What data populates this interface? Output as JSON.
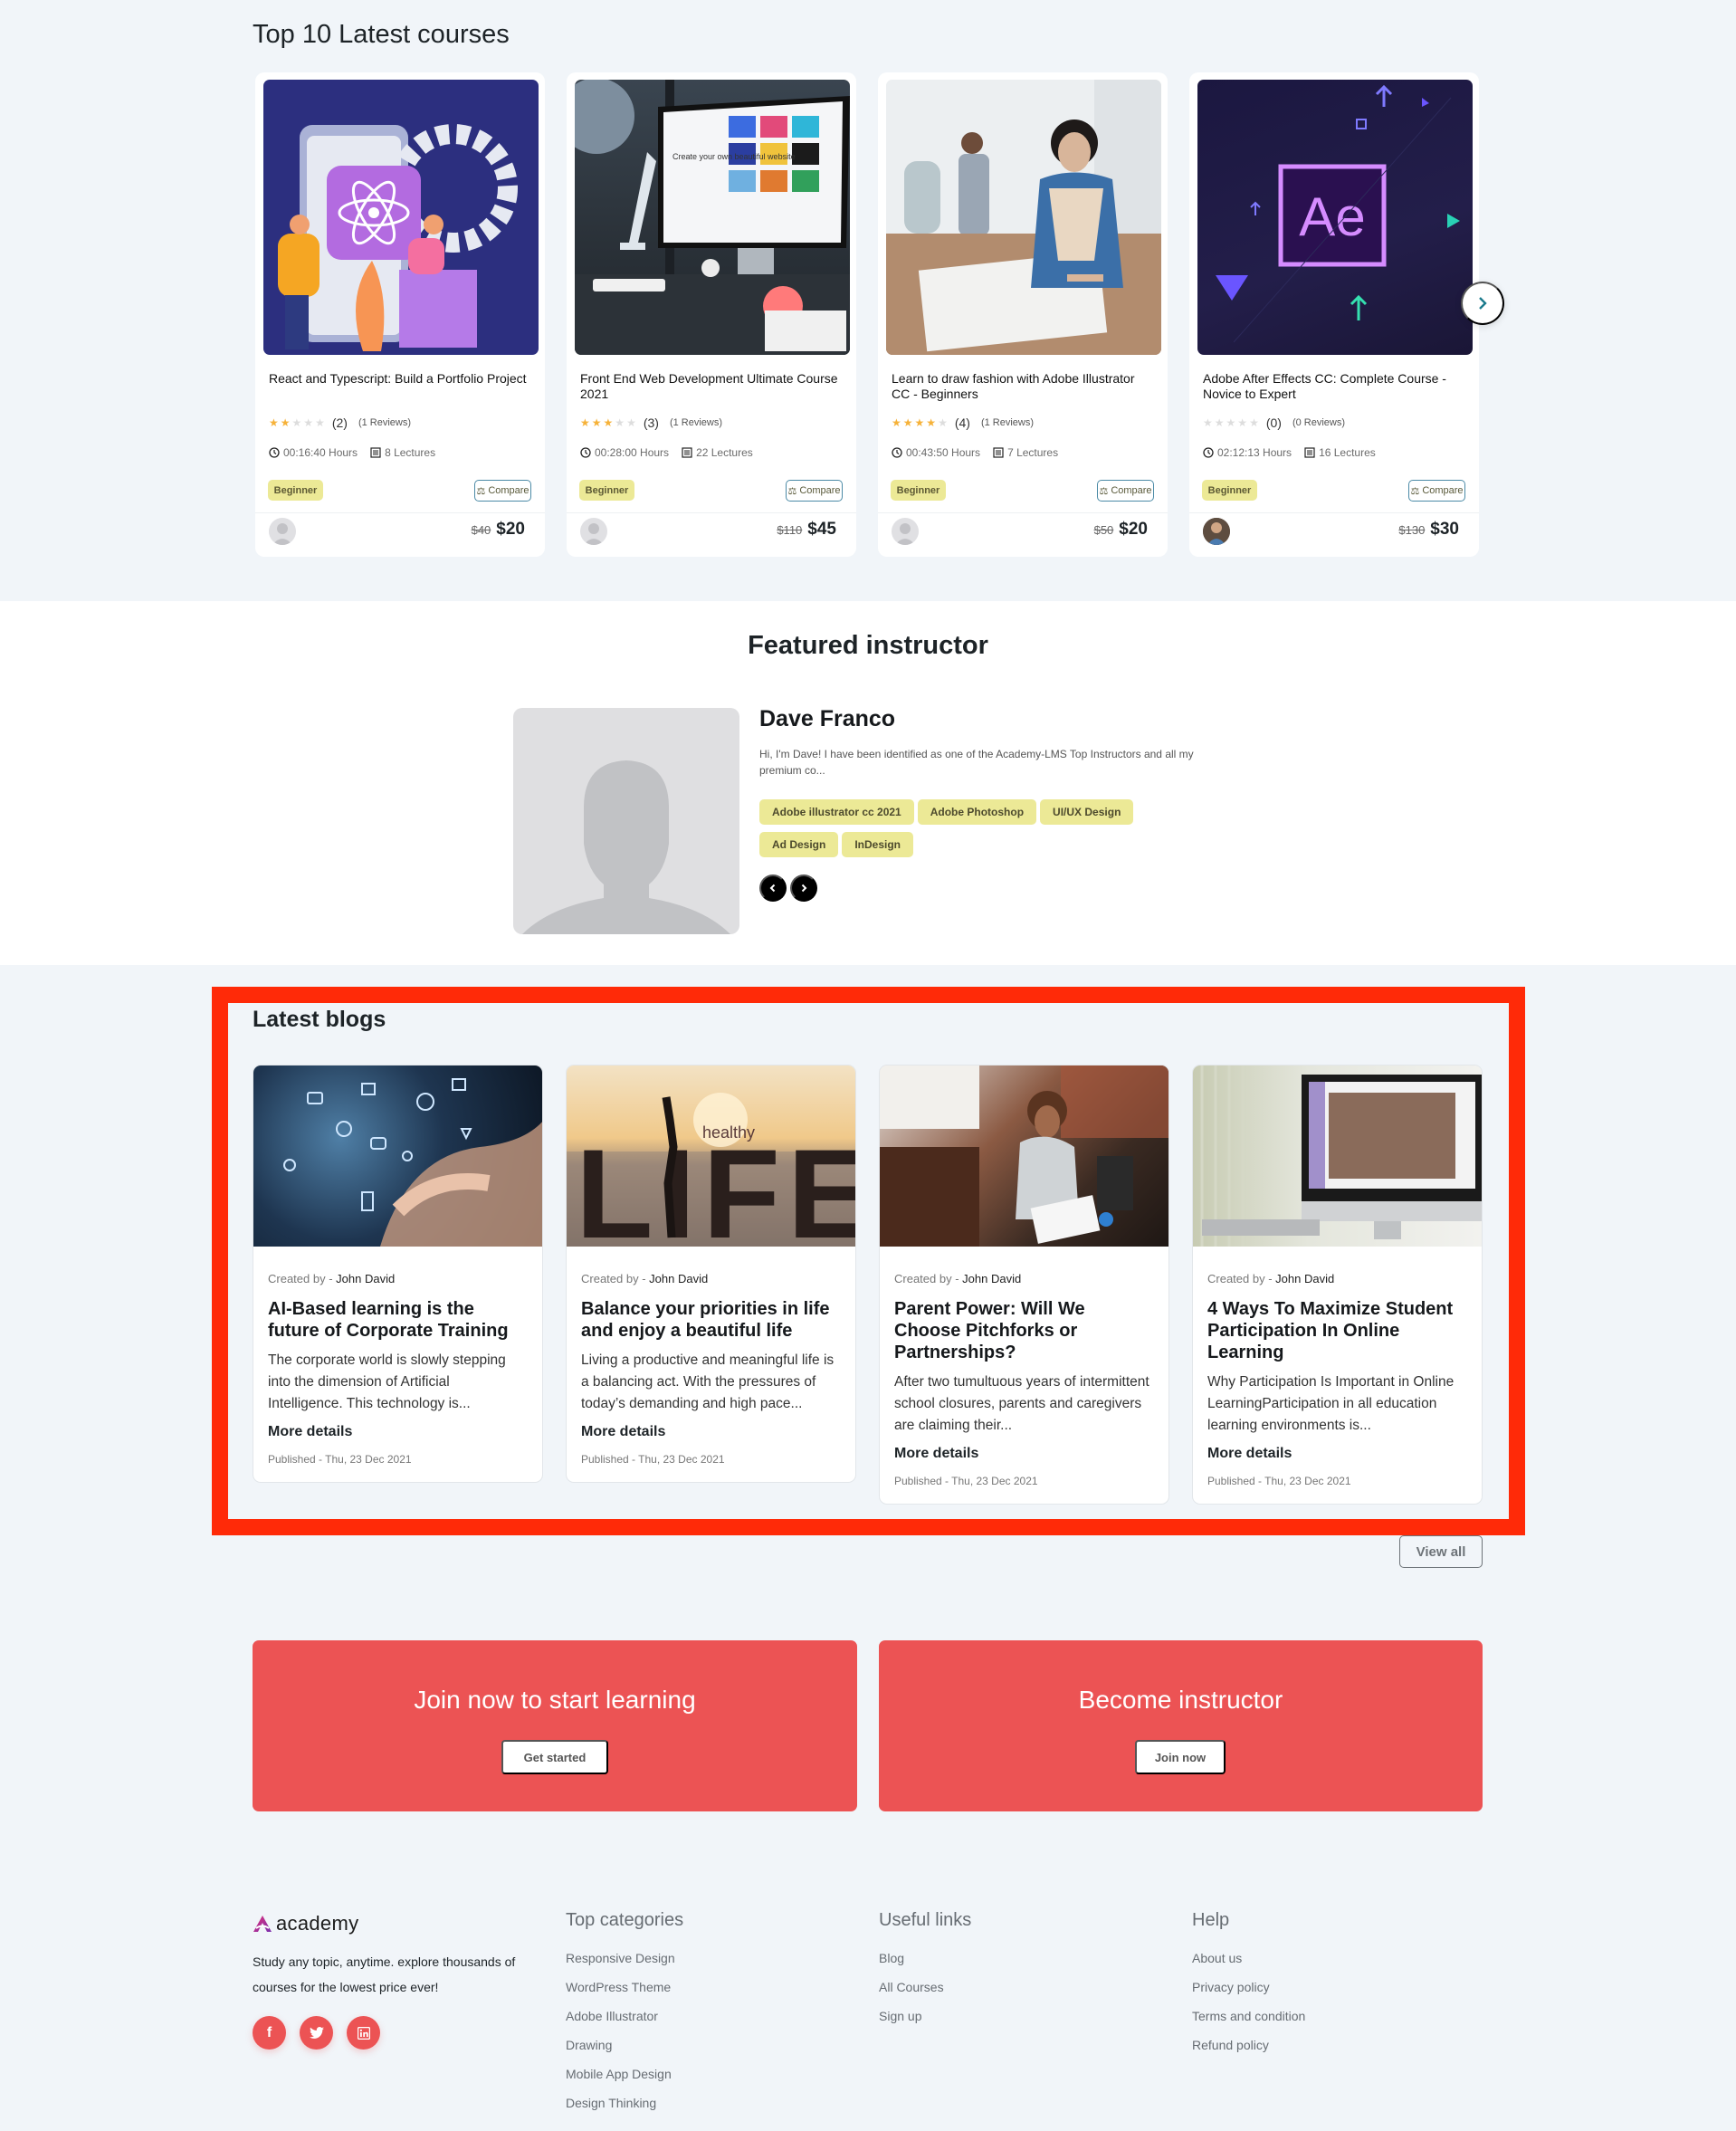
{
  "courses": {
    "title": "Top 10 Latest courses",
    "items": [
      {
        "name": "React and Typescript: Build a Portfolio Project",
        "stars": 2,
        "rating": "(2)",
        "reviews": "(1 Reviews)",
        "duration": "00:16:40 Hours",
        "lectures": "8 Lectures",
        "level": "Beginner",
        "compare": "Compare",
        "old_price": "$40",
        "price": "$20",
        "thumb": "react-illustration"
      },
      {
        "name": "Front End Web Development Ultimate Course 2021",
        "stars": 3,
        "rating": "(3)",
        "reviews": "(1 Reviews)",
        "duration": "00:28:00 Hours",
        "lectures": "22 Lectures",
        "level": "Beginner",
        "compare": "Compare",
        "old_price": "$110",
        "price": "$45",
        "thumb": "desk-computer-photo",
        "screen_text": "Create your own beautiful website"
      },
      {
        "name": "Learn to draw fashion with Adobe Illustrator CC - Beginners",
        "stars": 4,
        "rating": "(4)",
        "reviews": "(1 Reviews)",
        "duration": "00:43:50 Hours",
        "lectures": "7 Lectures",
        "level": "Beginner",
        "compare": "Compare",
        "old_price": "$50",
        "price": "$20",
        "thumb": "fashion-designer-photo"
      },
      {
        "name": "Adobe After Effects CC: Complete Course - Novice to Expert",
        "stars": 0,
        "rating": "(0)",
        "reviews": "(0 Reviews)",
        "duration": "02:12:13 Hours",
        "lectures": "16 Lectures",
        "level": "Beginner",
        "compare": "Compare",
        "old_price": "$130",
        "price": "$30",
        "thumb": "after-effects-logo",
        "logo_text": "Ae"
      }
    ],
    "next_icon": "chevron-right-icon"
  },
  "instructor": {
    "section_title": "Featured instructor",
    "name": "Dave Franco",
    "bio": "Hi, I'm Dave! I have been identified as one of the Academy-LMS Top Instructors and all my premium co...",
    "skills": [
      "Adobe illustrator cc 2021",
      "Adobe Photoshop",
      "UI/UX Design",
      "Ad Design",
      "InDesign"
    ],
    "prev_icon": "chevron-left-icon",
    "next_icon": "chevron-right-icon"
  },
  "blogs": {
    "title": "Latest blogs",
    "created_label": "Created by - ",
    "more_label": "More details",
    "view_all": "View all",
    "items": [
      {
        "author": "John David",
        "title": "AI-Based learning is the future of Corporate Training",
        "excerpt": "The corporate world is slowly stepping into the dimension of Artificial Intelligence. This technology is...",
        "published": "Published - Thu, 23 Dec 2021"
      },
      {
        "author": "John David",
        "title": "Balance your priorities in life and enjoy a beautiful life",
        "excerpt": "Living a productive and meaningful life is a balancing act. With the pressures of today’s demanding and high pace...",
        "published": "Published - Thu, 23 Dec 2021",
        "image_text": [
          "healthy",
          "LIFE"
        ]
      },
      {
        "author": "John David",
        "title": "Parent Power: Will We Choose Pitchforks or Partnerships?",
        "excerpt": "After two tumultuous years of intermittent school closures, parents and caregivers are claiming their...",
        "published": "Published - Thu, 23 Dec 2021"
      },
      {
        "author": "John David",
        "title": "4 Ways To Maximize Student Participation In Online Learning",
        "excerpt": "Why Participation Is Important in Online LearningParticipation in all education learning environments is...",
        "published": "Published - Thu, 23 Dec 2021"
      }
    ]
  },
  "cta": {
    "learn": {
      "title": "Join now to start learning",
      "button": "Get started"
    },
    "instructor": {
      "title": "Become instructor",
      "button": "Join now"
    }
  },
  "footer": {
    "logo_text": "academy",
    "tagline": "Study any topic, anytime. explore thousands of courses for the lowest price ever!",
    "social": [
      "facebook-icon",
      "twitter-icon",
      "linkedin-icon"
    ],
    "columns": [
      {
        "title": "Top categories",
        "links": [
          "Responsive Design",
          "WordPress Theme",
          "Adobe Illustrator",
          "Drawing",
          "Mobile App Design",
          "Design Thinking"
        ]
      },
      {
        "title": "Useful links",
        "links": [
          "Blog",
          "All Courses",
          "Sign up"
        ]
      },
      {
        "title": "Help",
        "links": [
          "About us",
          "Privacy policy",
          "Terms and condition",
          "Refund policy"
        ]
      }
    ]
  },
  "colors": {
    "accent": "#ec5354",
    "badge": "#ece996",
    "highlight_border": "#ff2a08",
    "page_bg": "#f1f5f9",
    "star": "#f6b239"
  }
}
